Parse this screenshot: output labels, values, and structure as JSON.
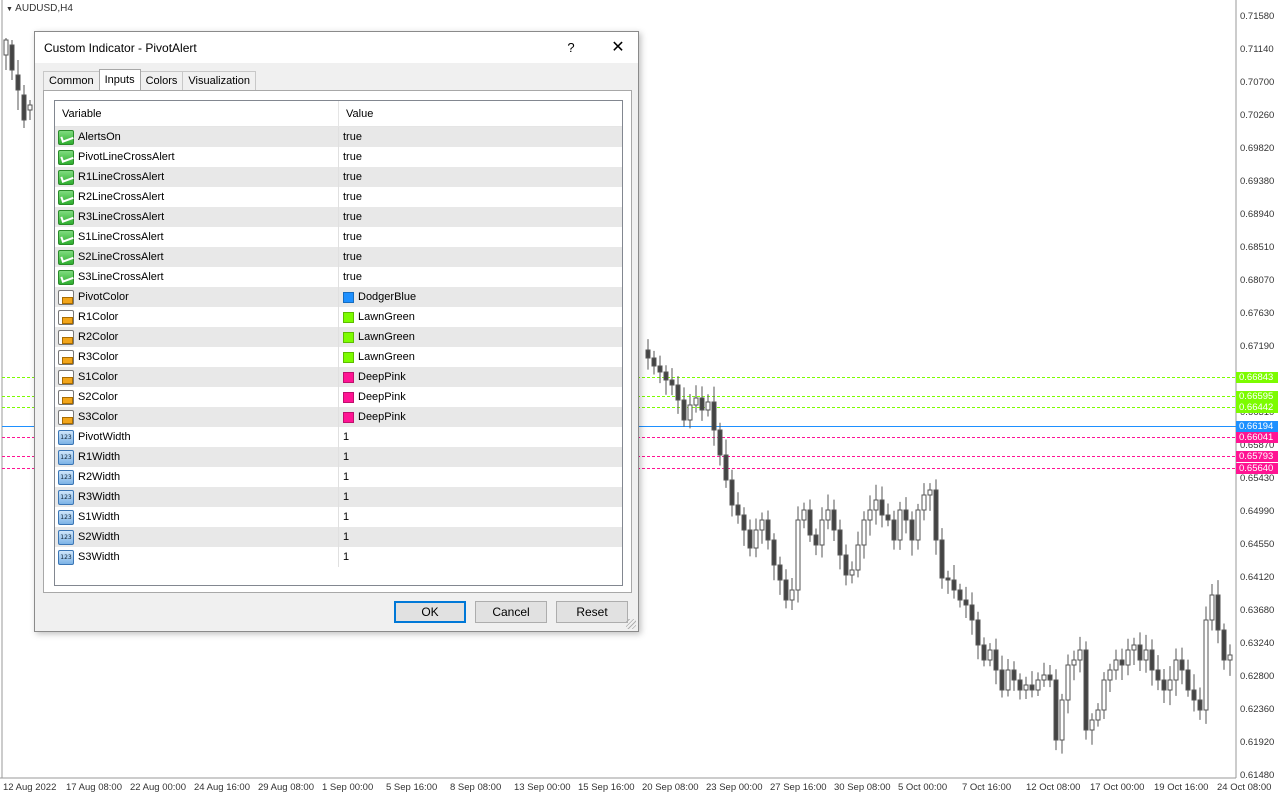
{
  "chart": {
    "symbol_title": "AUDUSD,H4",
    "price_labels": [
      "0.71580",
      "0.71140",
      "0.70700",
      "0.70260",
      "0.69820",
      "0.69380",
      "0.68940",
      "0.68510",
      "0.68070",
      "0.67630",
      "0.67190",
      "0.66750",
      "0.66310",
      "0.65870",
      "0.65430",
      "0.64990",
      "0.64550",
      "0.64120",
      "0.63680",
      "0.63240",
      "0.62800",
      "0.62360",
      "0.61920",
      "0.61480"
    ],
    "level_tags": [
      {
        "value": "0.66843",
        "color": "#7cfc00"
      },
      {
        "value": "0.66595",
        "color": "#7cfc00"
      },
      {
        "value": "0.66442",
        "color": "#7cfc00"
      },
      {
        "value": "0.66194",
        "color": "#1e90ff"
      },
      {
        "value": "0.66041",
        "color": "#ff1493"
      },
      {
        "value": "0.65793",
        "color": "#ff1493"
      },
      {
        "value": "0.65640",
        "color": "#ff1493"
      }
    ],
    "date_labels": [
      "12 Aug 2022",
      "17 Aug 08:00",
      "22 Aug 00:00",
      "24 Aug 16:00",
      "29 Aug 08:00",
      "1 Sep 00:00",
      "5 Sep 16:00",
      "8 Sep 08:00",
      "13 Sep 00:00",
      "15 Sep 16:00",
      "20 Sep 08:00",
      "23 Sep 00:00",
      "27 Sep 16:00",
      "30 Sep 08:00",
      "5 Oct 00:00",
      "7 Oct 16:00",
      "12 Oct 08:00",
      "17 Oct 00:00",
      "19 Oct 16:00",
      "24 Oct 08:00"
    ]
  },
  "dialog": {
    "title": "Custom Indicator - PivotAlert",
    "help_label": "?",
    "close_label": "✕",
    "tabs": [
      "Common",
      "Inputs",
      "Colors",
      "Visualization"
    ],
    "active_tab": "Inputs",
    "columns": {
      "variable": "Variable",
      "value": "Value"
    },
    "rows": [
      {
        "type": "bool",
        "name": "AlertsOn",
        "value": "true"
      },
      {
        "type": "bool",
        "name": "PivotLineCrossAlert",
        "value": "true"
      },
      {
        "type": "bool",
        "name": "R1LineCrossAlert",
        "value": "true"
      },
      {
        "type": "bool",
        "name": "R2LineCrossAlert",
        "value": "true"
      },
      {
        "type": "bool",
        "name": "R3LineCrossAlert",
        "value": "true"
      },
      {
        "type": "bool",
        "name": "S1LineCrossAlert",
        "value": "true"
      },
      {
        "type": "bool",
        "name": "S2LineCrossAlert",
        "value": "true"
      },
      {
        "type": "bool",
        "name": "S3LineCrossAlert",
        "value": "true"
      },
      {
        "type": "color",
        "name": "PivotColor",
        "value": "DodgerBlue",
        "swatch": "#1e90ff"
      },
      {
        "type": "color",
        "name": "R1Color",
        "value": "LawnGreen",
        "swatch": "#7cfc00"
      },
      {
        "type": "color",
        "name": "R2Color",
        "value": "LawnGreen",
        "swatch": "#7cfc00"
      },
      {
        "type": "color",
        "name": "R3Color",
        "value": "LawnGreen",
        "swatch": "#7cfc00"
      },
      {
        "type": "color",
        "name": "S1Color",
        "value": "DeepPink",
        "swatch": "#ff1493"
      },
      {
        "type": "color",
        "name": "S2Color",
        "value": "DeepPink",
        "swatch": "#ff1493"
      },
      {
        "type": "color",
        "name": "S3Color",
        "value": "DeepPink",
        "swatch": "#ff1493"
      },
      {
        "type": "num",
        "name": "PivotWidth",
        "value": "1"
      },
      {
        "type": "num",
        "name": "R1Width",
        "value": "1"
      },
      {
        "type": "num",
        "name": "R2Width",
        "value": "1"
      },
      {
        "type": "num",
        "name": "R3Width",
        "value": "1"
      },
      {
        "type": "num",
        "name": "S1Width",
        "value": "1"
      },
      {
        "type": "num",
        "name": "S2Width",
        "value": "1"
      },
      {
        "type": "num",
        "name": "S3Width",
        "value": "1"
      }
    ],
    "buttons": {
      "ok": "OK",
      "cancel": "Cancel",
      "reset": "Reset"
    }
  }
}
